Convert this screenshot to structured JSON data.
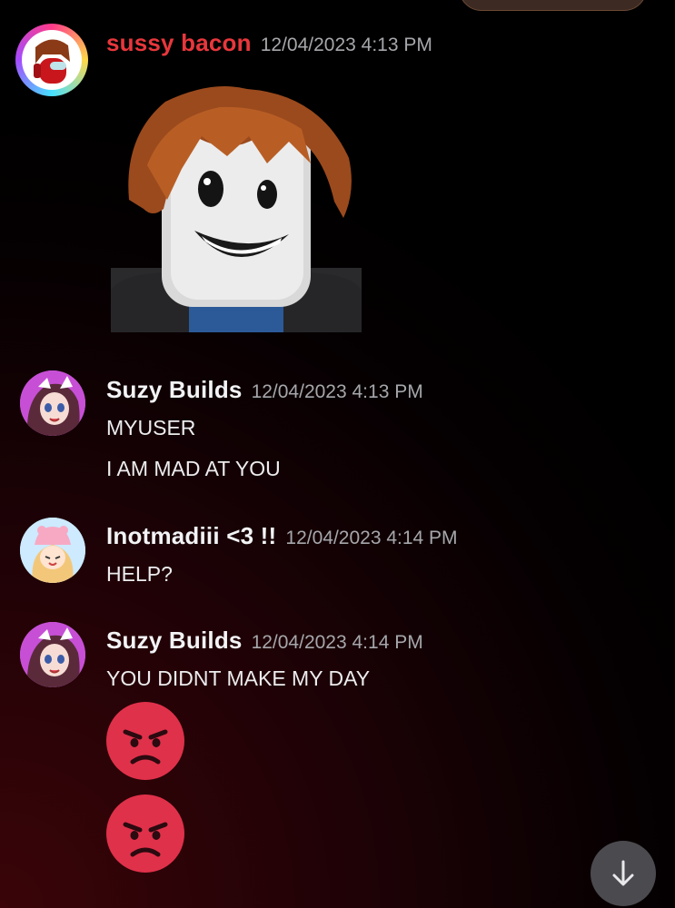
{
  "messages": [
    {
      "username": "sussy bacon",
      "username_color": "#e8373c",
      "timestamp": "12/04/2023 4:13 PM",
      "attachment": "roblox-bacon-hair-avatar-image",
      "lines": []
    },
    {
      "username": "Suzy Builds",
      "username_color": "#f2f3f5",
      "timestamp": "12/04/2023 4:13 PM",
      "lines": [
        "MYUSER",
        "I AM MAD AT YOU"
      ]
    },
    {
      "username": "Inotmadiii <3 !!",
      "username_color": "#f2f3f5",
      "timestamp": "12/04/2023 4:14 PM",
      "lines": [
        "HELP?"
      ]
    },
    {
      "username": "Suzy Builds",
      "username_color": "#f2f3f5",
      "timestamp": "12/04/2023 4:14 PM",
      "lines": [
        "YOU DIDNT MAKE MY DAY"
      ],
      "emojis": [
        "angry-face-emoji",
        "angry-face-emoji"
      ]
    }
  ],
  "icons": {
    "scroll_down": "arrow-down-icon"
  },
  "colors": {
    "accent_red": "#e8373c",
    "emoji_red": "#e0314a",
    "timestamp_gray": "#a6a7ab"
  }
}
